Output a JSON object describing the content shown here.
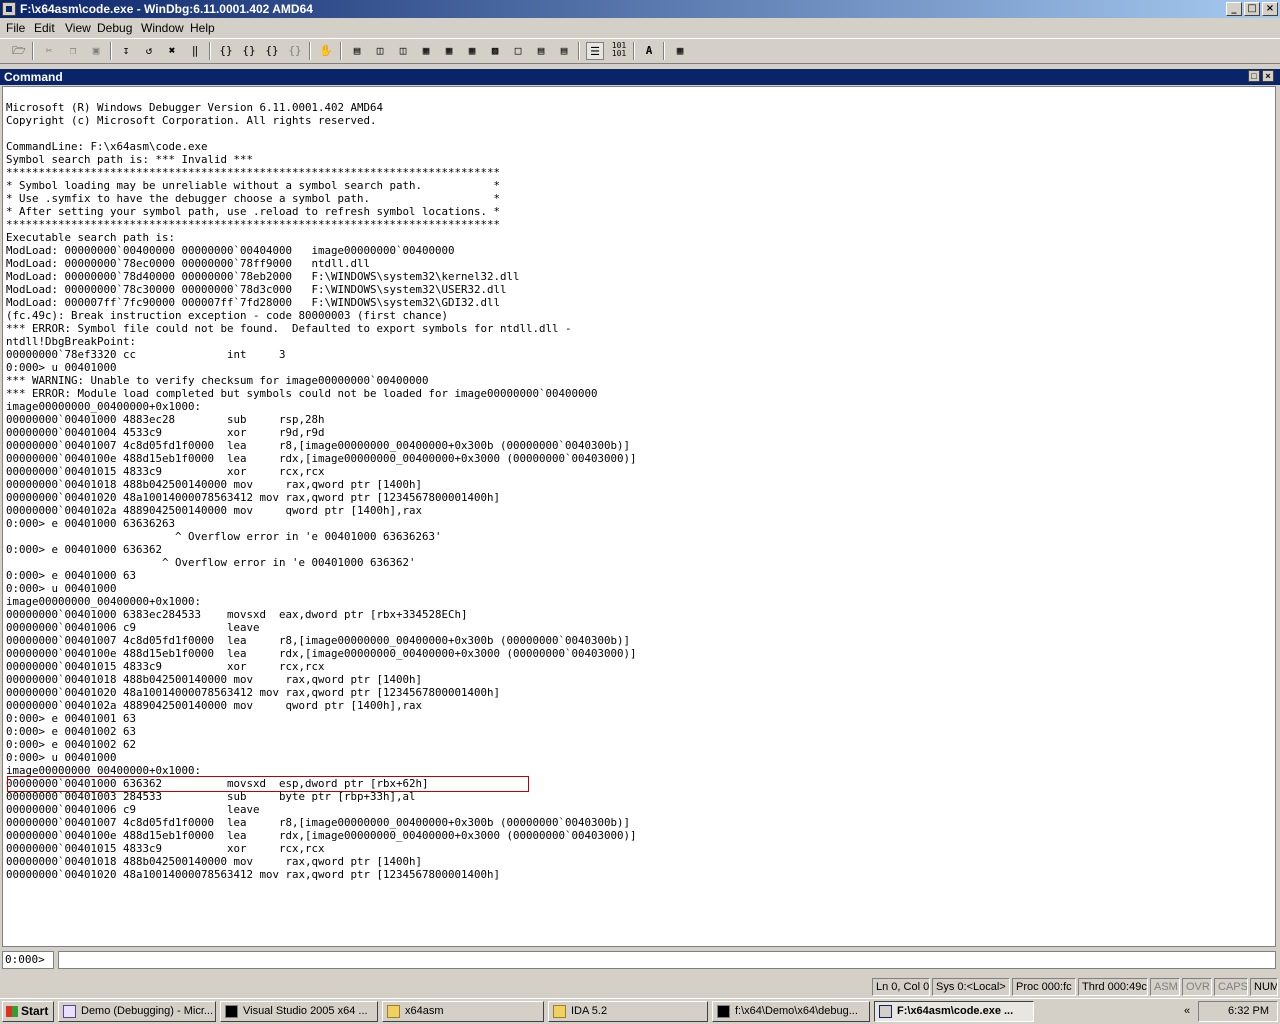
{
  "window": {
    "title": "F:\\x64asm\\code.exe - WinDbg:6.11.0001.402 AMD64",
    "minimize": "_",
    "maximize": "□",
    "close": "×"
  },
  "menu": {
    "file": "File",
    "edit": "Edit",
    "view": "View",
    "debug": "Debug",
    "window": "Window",
    "help": "Help"
  },
  "command_window": {
    "title": "Command",
    "output": "Microsoft (R) Windows Debugger Version 6.11.0001.402 AMD64\nCopyright (c) Microsoft Corporation. All rights reserved.\n\nCommandLine: F:\\x64asm\\code.exe\nSymbol search path is: *** Invalid ***\n****************************************************************************\n* Symbol loading may be unreliable without a symbol search path.           *\n* Use .symfix to have the debugger choose a symbol path.                   *\n* After setting your symbol path, use .reload to refresh symbol locations. *\n****************************************************************************\nExecutable search path is:\nModLoad: 00000000`00400000 00000000`00404000   image00000000`00400000\nModLoad: 00000000`78ec0000 00000000`78ff9000   ntdll.dll\nModLoad: 00000000`78d40000 00000000`78eb2000   F:\\WINDOWS\\system32\\kernel32.dll\nModLoad: 00000000`78c30000 00000000`78d3c000   F:\\WINDOWS\\system32\\USER32.dll\nModLoad: 000007ff`7fc90000 000007ff`7fd28000   F:\\WINDOWS\\system32\\GDI32.dll\n(fc.49c): Break instruction exception - code 80000003 (first chance)\n*** ERROR: Symbol file could not be found.  Defaulted to export symbols for ntdll.dll -\nntdll!DbgBreakPoint:\n00000000`78ef3320 cc              int     3\n0:000> u 00401000\n*** WARNING: Unable to verify checksum for image00000000`00400000\n*** ERROR: Module load completed but symbols could not be loaded for image00000000`00400000\nimage00000000_00400000+0x1000:\n00000000`00401000 4883ec28        sub     rsp,28h\n00000000`00401004 4533c9          xor     r9d,r9d\n00000000`00401007 4c8d05fd1f0000  lea     r8,[image00000000_00400000+0x300b (00000000`0040300b)]\n00000000`0040100e 488d15eb1f0000  lea     rdx,[image00000000_00400000+0x3000 (00000000`00403000)]\n00000000`00401015 4833c9          xor     rcx,rcx\n00000000`00401018 488b042500140000 mov     rax,qword ptr [1400h]\n00000000`00401020 48a10014000078563412 mov rax,qword ptr [1234567800001400h]\n00000000`0040102a 4889042500140000 mov     qword ptr [1400h],rax\n0:000> e 00401000 63636263\n                          ^ Overflow error in 'e 00401000 63636263'\n0:000> e 00401000 636362\n                        ^ Overflow error in 'e 00401000 636362'\n0:000> e 00401000 63\n0:000> u 00401000\nimage00000000_00400000+0x1000:\n00000000`00401000 6383ec284533    movsxd  eax,dword ptr [rbx+334528ECh]\n00000000`00401006 c9              leave\n00000000`00401007 4c8d05fd1f0000  lea     r8,[image00000000_00400000+0x300b (00000000`0040300b)]\n00000000`0040100e 488d15eb1f0000  lea     rdx,[image00000000_00400000+0x3000 (00000000`00403000)]\n00000000`00401015 4833c9          xor     rcx,rcx\n00000000`00401018 488b042500140000 mov     rax,qword ptr [1400h]\n00000000`00401020 48a10014000078563412 mov rax,qword ptr [1234567800001400h]\n00000000`0040102a 4889042500140000 mov     qword ptr [1400h],rax\n0:000> e 00401001 63\n0:000> e 00401002 63\n0:000> e 00401002 62\n0:000> u 00401000\nimage00000000_00400000+0x1000:\n00000000`00401000 636362          movsxd  esp,dword ptr [rbx+62h]\n00000000`00401003 284533          sub     byte ptr [rbp+33h],al\n00000000`00401006 c9              leave\n00000000`00401007 4c8d05fd1f0000  lea     r8,[image00000000_00400000+0x300b (00000000`0040300b)]\n00000000`0040100e 488d15eb1f0000  lea     rdx,[image00000000_00400000+0x3000 (00000000`00403000)]\n00000000`00401015 4833c9          xor     rcx,rcx\n00000000`00401018 488b042500140000 mov     rax,qword ptr [1400h]\n00000000`00401020 48a10014000078563412 mov rax,qword ptr [1234567800001400h]",
    "prompt": "0:000>",
    "input_value": ""
  },
  "status": {
    "position": "Ln 0, Col 0",
    "sys": "Sys 0:<Local>",
    "proc": "Proc 000:fc",
    "thrd": "Thrd 000:49c",
    "asm": "ASM",
    "ovr": "OVR",
    "caps": "CAPS",
    "num": "NUM"
  },
  "taskbar": {
    "start": "Start",
    "tasks": [
      {
        "label": "Demo (Debugging) - Micr..."
      },
      {
        "label": "Visual Studio 2005 x64 ..."
      },
      {
        "label": "x64asm"
      },
      {
        "label": "IDA 5.2"
      },
      {
        "label": "f:\\x64\\Demo\\x64\\debug..."
      },
      {
        "label": "F:\\x64asm\\code.exe ..."
      }
    ],
    "chevron": "«",
    "clock": "6:32 PM"
  },
  "colors": {
    "titlebar": "#0a246a",
    "face": "#d4d0c8",
    "highlight_box": "#c00000"
  }
}
